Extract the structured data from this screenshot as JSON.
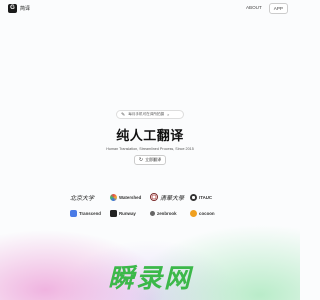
{
  "header": {
    "logo_mark": "G",
    "logo_text": "简译",
    "nav": [
      {
        "label": "ABOUT"
      },
      {
        "label": "APP"
      }
    ]
  },
  "hero": {
    "announcement": "每月手机可在译所拍摄",
    "announcement_chevron": ">",
    "title": "纯人工翻译",
    "subtitle": "Human Translation, Streamlined Process, Since 2015",
    "cta_label": "立即翻译"
  },
  "brands": [
    {
      "label": "北京大学",
      "icon": "calligraphy-logo",
      "color": "#222222"
    },
    {
      "label": "Watershed",
      "icon": "watershed-logo",
      "color": "#3b6fe0"
    },
    {
      "label": "清華大學",
      "icon": "tsinghua-seal",
      "color": "#7a2a2a"
    },
    {
      "label": "ITAUC",
      "icon": "itauc-logo",
      "color": "#333333"
    },
    {
      "label": "Transcend",
      "icon": "transcend-logo",
      "color": "#4a7be6"
    },
    {
      "label": "Runway",
      "icon": "runway-logo",
      "color": "#222222"
    },
    {
      "label": "zenbrook",
      "icon": "zenbrook-logo",
      "color": "#444444"
    },
    {
      "label": "cocoon",
      "icon": "cocoon-logo",
      "color": "#f0a020"
    }
  ],
  "watermark": "瞬录网"
}
